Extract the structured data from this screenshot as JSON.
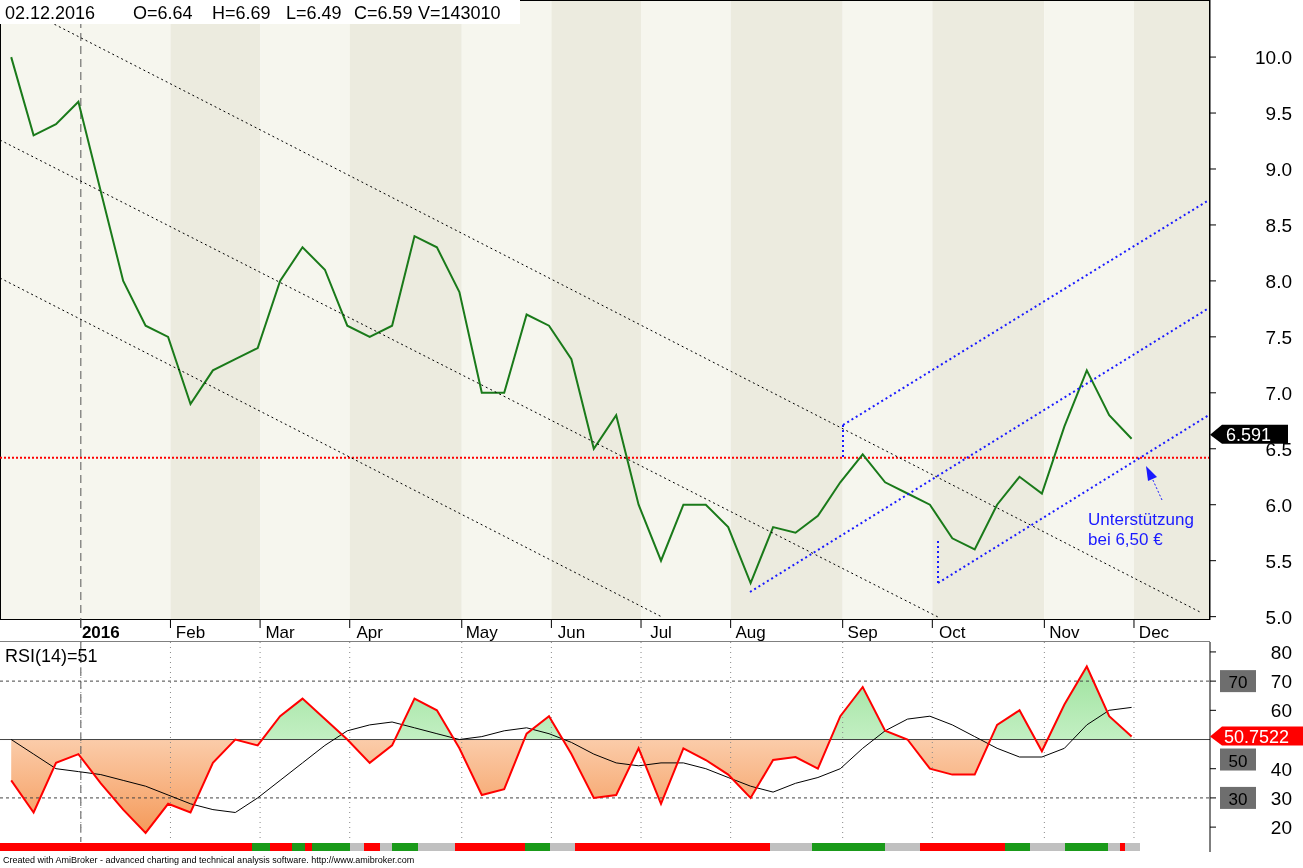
{
  "header": {
    "date": "02.12.2016",
    "quote": [
      "O=6.64",
      "H=6.69",
      "L=6.49",
      "C=6.59",
      "V=143010"
    ]
  },
  "price_chart": {
    "chart_data": {
      "type": "line",
      "ylim": [
        4.97,
        10.51
      ],
      "categories": [
        null,
        null,
        null,
        null,
        "2016",
        null,
        null,
        null,
        "Feb",
        null,
        null,
        null,
        "Mar",
        null,
        null,
        null,
        "Apr",
        null,
        null,
        null,
        null,
        "May",
        null,
        null,
        null,
        "Jun",
        null,
        null,
        null,
        "Jul",
        null,
        null,
        null,
        "Aug",
        null,
        null,
        null,
        null,
        "Sep",
        null,
        null,
        null,
        "Oct",
        null,
        null,
        null,
        null,
        "Nov",
        null,
        null,
        null,
        "Dec",
        null,
        null
      ],
      "series": [
        {
          "color": "#1a7a1a",
          "values": [
            10.0,
            9.3,
            9.4,
            9.6,
            8.8,
            8.0,
            7.6,
            7.5,
            6.9,
            7.2,
            7.3,
            7.4,
            8.0,
            8.3,
            8.1,
            7.6,
            7.5,
            7.6,
            8.4,
            8.3,
            7.9,
            7.0,
            7.0,
            7.7,
            7.6,
            7.3,
            6.5,
            6.8,
            6.0,
            5.5,
            6.0,
            6.0,
            5.8,
            5.3,
            5.8,
            5.75,
            5.9,
            6.2,
            6.45,
            6.2,
            6.1,
            6.0,
            5.7,
            5.6,
            6.0,
            6.25,
            6.1,
            6.7,
            7.2,
            6.8,
            6.59,
            null,
            null,
            null
          ]
        }
      ],
      "ref_lines": [
        {
          "axis": "y",
          "value": 6.42,
          "color": "#ff0000"
        }
      ],
      "yticks": [
        {
          "value": 5,
          "label": "5.0"
        },
        {
          "value": 5.5,
          "label": "5.5"
        },
        {
          "value": 6,
          "label": "6.0"
        },
        {
          "value": 6.5,
          "label": "6.5"
        },
        {
          "value": 7,
          "label": "7.0"
        },
        {
          "value": 7.5,
          "label": "7.5"
        },
        {
          "value": 8,
          "label": "8.0"
        },
        {
          "value": 8.5,
          "label": "8.5"
        },
        {
          "value": 9,
          "label": "9.0"
        },
        {
          "value": 9.5,
          "label": "9.5"
        },
        {
          "value": 10,
          "label": "10.0"
        }
      ]
    },
    "last_price_label": "6.591",
    "support_note": {
      "lines": [
        "Unterstützung",
        "bei 6,50 €"
      ]
    }
  },
  "rsi_chart": {
    "title": "RSI(14)=51",
    "chart_data": {
      "type": "line",
      "ylim": [
        14.9,
        83.4
      ],
      "grid": true,
      "categories": [
        null,
        null,
        null,
        null,
        null,
        null,
        null,
        null,
        null,
        null,
        null,
        null,
        null,
        null,
        null,
        null,
        null,
        null,
        null,
        null,
        null,
        null,
        null,
        null,
        null,
        null,
        null,
        null,
        null,
        null,
        null,
        null,
        null,
        null,
        null,
        null,
        null,
        null,
        null,
        null,
        null,
        null,
        null,
        null,
        null,
        null,
        null,
        null,
        null,
        null,
        null,
        null,
        null,
        null
      ],
      "series": [
        {
          "color": "#ff0000",
          "values": [
            36,
            25,
            42,
            45,
            35,
            26,
            18,
            28,
            25,
            42,
            50,
            48,
            58,
            64,
            57,
            50,
            42,
            48,
            64,
            60,
            47,
            31,
            33,
            52,
            58,
            45,
            30,
            31,
            47,
            28,
            47,
            43,
            38,
            30,
            43,
            44,
            40,
            58,
            68,
            53,
            50,
            40,
            38,
            38,
            55,
            60,
            46,
            62,
            75,
            58,
            51,
            null,
            null,
            null
          ]
        },
        {
          "color": "#000000",
          "values": [
            50,
            45,
            40,
            39,
            38,
            36,
            34,
            31,
            28,
            26,
            25,
            30,
            36,
            42,
            48,
            53,
            55,
            56,
            54,
            52,
            50,
            51,
            53,
            54,
            52,
            49,
            45,
            42,
            41,
            42,
            42,
            40,
            37,
            34,
            32,
            35,
            37,
            40,
            47,
            53,
            57,
            58,
            55,
            51,
            47,
            44,
            44,
            47,
            55,
            60,
            61,
            null,
            null,
            null
          ]
        }
      ],
      "ref_lines": [
        {
          "axis": "y",
          "value": 70,
          "color": "#444444"
        },
        {
          "axis": "y",
          "value": 50,
          "color": "#444444"
        },
        {
          "axis": "y",
          "value": 30,
          "color": "#444444"
        }
      ],
      "yticks": [
        {
          "value": 20,
          "label": "20"
        },
        {
          "value": 30,
          "label": "30"
        },
        {
          "value": 40,
          "label": "40"
        },
        {
          "value": 60,
          "label": "60"
        },
        {
          "value": 70,
          "label": "70"
        },
        {
          "value": 80,
          "label": "80"
        }
      ]
    },
    "level_labels": [
      "70",
      "50",
      "30"
    ],
    "last_value_label": "50.7522"
  },
  "footer": "Created with AmiBroker - advanced charting and technical analysis software. http://www.amibroker.com"
}
